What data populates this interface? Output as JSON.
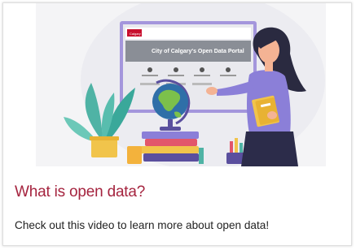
{
  "card": {
    "thumbnail": {
      "icon": "video-thumbnail-illustration",
      "screen_badge": "Calgary",
      "screen_heading": "City of Calgary's Open Data Portal",
      "accent_color": "#c8102e"
    },
    "title": "What is open data?",
    "description": "Check out this video to learn more about open data!"
  },
  "colors": {
    "title": "#a5243f",
    "text": "#222222",
    "screen_frame": "#9b8ad6",
    "shirt": "#8b7fd8",
    "globe_land": "#7cc04b",
    "globe_water": "#2f6fa8"
  }
}
